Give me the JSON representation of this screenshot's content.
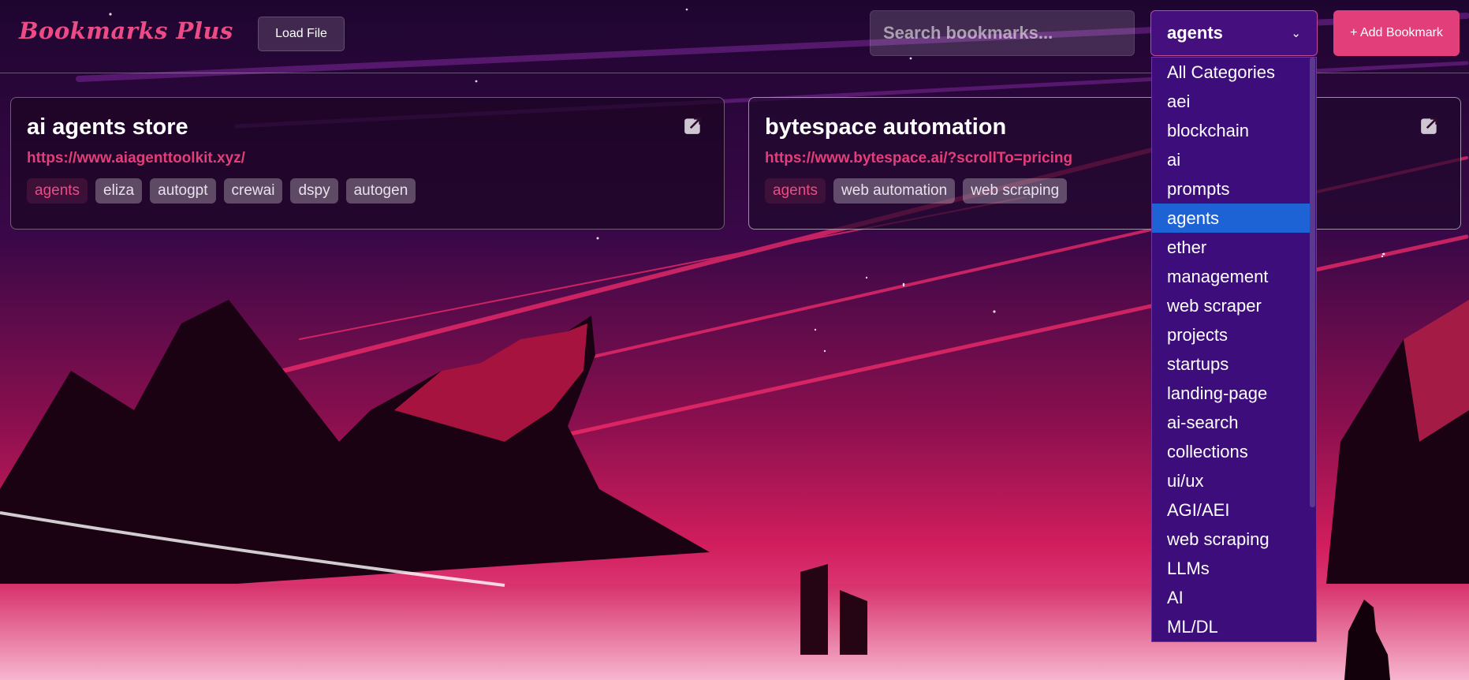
{
  "app": {
    "title": "Bookmarks Plus"
  },
  "toolbar": {
    "load_label": "Load File",
    "search_placeholder": "Search bookmarks...",
    "category_selected": "agents",
    "add_label": "+ Add Bookmark"
  },
  "bookmarks": [
    {
      "title": "ai agents store",
      "url": "https://www.aiagenttoolkit.xyz/",
      "tags": [
        "agents",
        "eliza",
        "autogpt",
        "crewai",
        "dspy",
        "autogen"
      ]
    },
    {
      "title": "bytespace automation",
      "url": "https://www.bytespace.ai/?scrollTo=pricing",
      "tags": [
        "agents",
        "web automation",
        "web scraping"
      ]
    }
  ],
  "categories": [
    "All Categories",
    "aei",
    "blockchain",
    "ai",
    "prompts",
    "agents",
    "ether",
    "management",
    "web scraper",
    "projects",
    "startups",
    "landing-page",
    "ai-search",
    "collections",
    "ui/ux",
    "AGI/AEI",
    "web scraping",
    "LLMs",
    "AI",
    "ML/DL"
  ],
  "colors": {
    "accent": "#e23e79",
    "dropdown_bg": "#3d0d7c",
    "selected_option": "#1d63d6"
  }
}
